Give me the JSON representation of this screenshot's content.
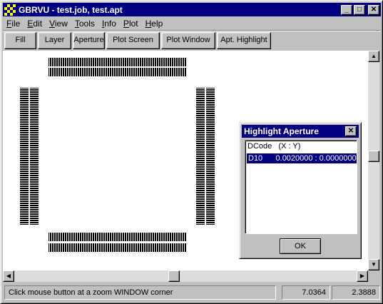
{
  "window": {
    "title": "GBRVU - test.job, test.apt",
    "minimize": "_",
    "maximize": "□",
    "close": "✕"
  },
  "menu": {
    "file": {
      "u": "F",
      "rest": "ile"
    },
    "edit": {
      "u": "E",
      "rest": "dit"
    },
    "view": {
      "u": "V",
      "rest": "iew"
    },
    "tools": {
      "u": "T",
      "rest": "ools"
    },
    "info": {
      "u": "I",
      "rest": "nfo"
    },
    "plot": {
      "u": "P",
      "rest": "lot"
    },
    "help": {
      "u": "H",
      "rest": "elp"
    }
  },
  "toolbar": {
    "fill": "Fill",
    "layer": "Layer",
    "aperture": "Aperture",
    "plot_screen": "Plot Screen",
    "plot_window": "Plot Window",
    "apt_highlight": "Apt. Highlight"
  },
  "dialog": {
    "title": "Highlight Aperture",
    "close": "✕",
    "header": "DCode   (X : Y)",
    "row": "D10      0.0020000 : 0.0000000",
    "ok": "OK"
  },
  "status": {
    "message": "Click mouse button at a zoom WINDOW corner",
    "x": "7.0364",
    "y": "2.3888"
  },
  "colors": {
    "titlebar": "#000080",
    "face": "#c0c0c0",
    "highlight_row": "#000080"
  }
}
